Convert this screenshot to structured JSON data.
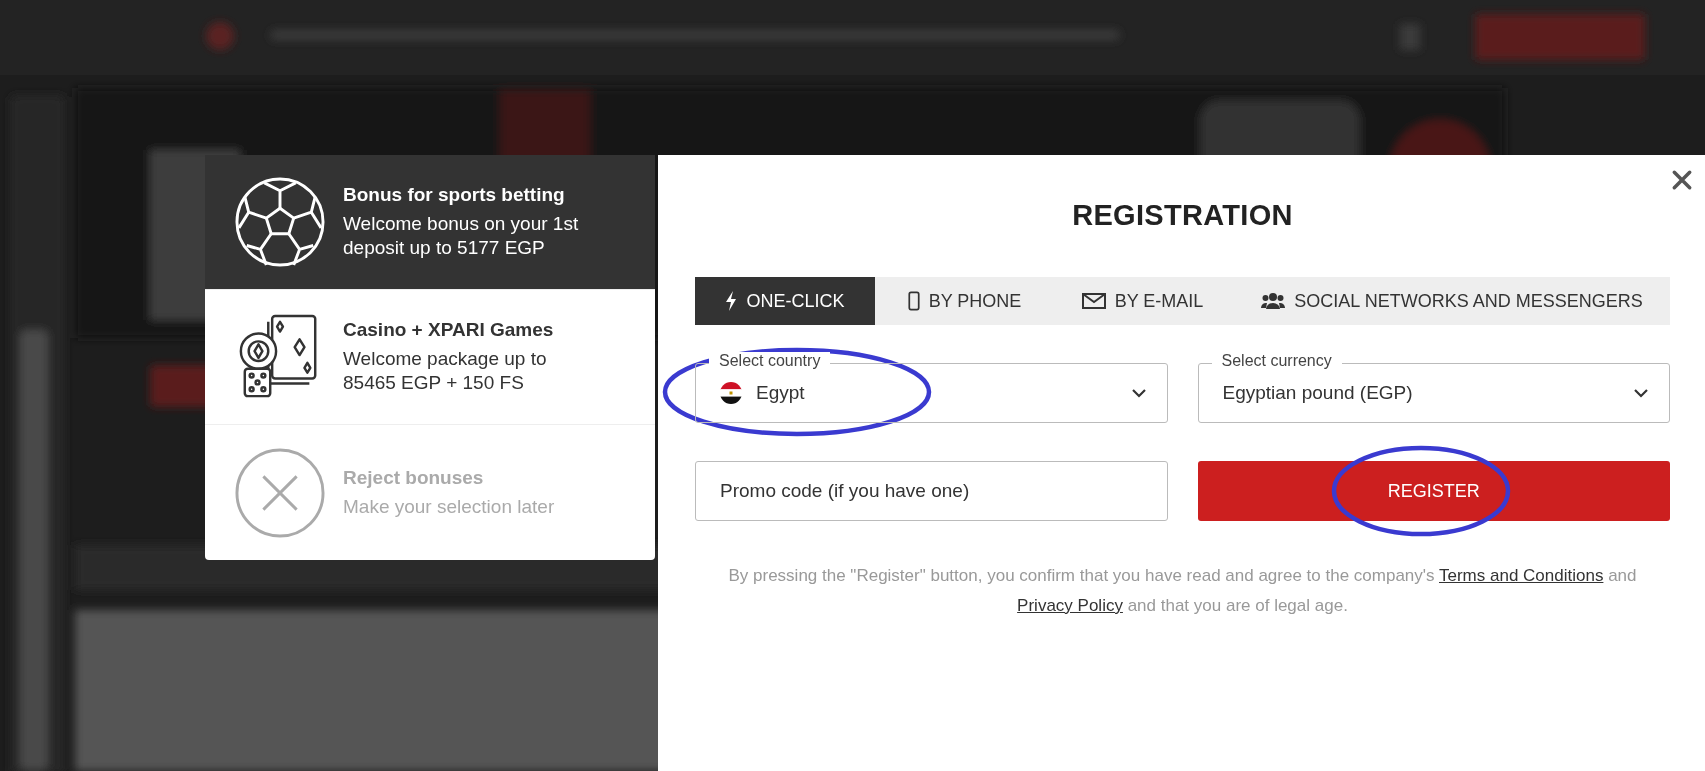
{
  "bonus_panel": {
    "options": [
      {
        "kind": "sports",
        "title": "Bonus for sports betting",
        "description": "Welcome bonus on your 1st deposit up to 5177 EGP",
        "selected": true
      },
      {
        "kind": "casino",
        "title": "Casino + XPARI Games",
        "description": "Welcome package up to 85465 EGP + 150 FS",
        "selected": false
      },
      {
        "kind": "reject",
        "title": "Reject bonuses",
        "description": "Make your selection later",
        "selected": false
      }
    ]
  },
  "registration": {
    "title": "REGISTRATION",
    "tabs": [
      {
        "kind": "bolt",
        "label": "ONE-CLICK",
        "selected": true
      },
      {
        "kind": "phone",
        "label": "BY PHONE",
        "selected": false
      },
      {
        "kind": "mail",
        "label": "BY E-MAIL",
        "selected": false
      },
      {
        "kind": "people",
        "label": "SOCIAL NETWORKS AND MESSENGERS",
        "selected": false
      }
    ],
    "country": {
      "label": "Select country",
      "value": "Egypt",
      "highlighted": true
    },
    "currency": {
      "label": "Select currency",
      "value": "Egyptian pound (EGP)"
    },
    "promo": {
      "placeholder": "Promo code (if you have one)"
    },
    "register_button": {
      "label": "REGISTER",
      "highlighted": true
    },
    "terms": [
      {
        "kind": "text",
        "text": "By pressing the \"Register\" button, you confirm that you have read and agree to the company's "
      },
      {
        "kind": "link",
        "text": "Terms and Conditions"
      },
      {
        "kind": "text",
        "text": " and "
      },
      {
        "kind": "link",
        "text": "Privacy Policy"
      },
      {
        "kind": "text",
        "text": " and that you are of legal age."
      }
    ]
  }
}
